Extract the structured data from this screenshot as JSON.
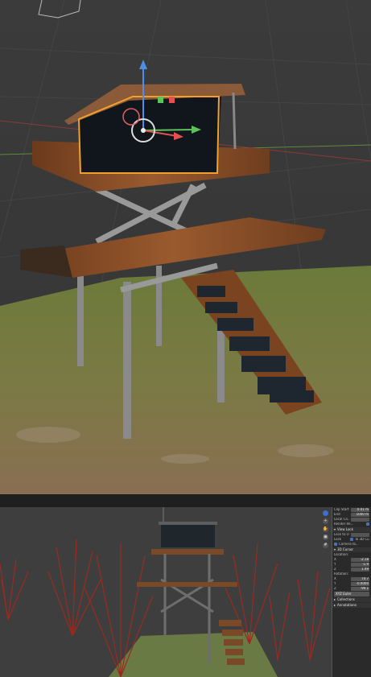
{
  "top_viewport": {
    "description_icons": [
      "translate-gizmo-icon",
      "camera-wireframe-icon"
    ]
  },
  "bottom_viewport": {
    "n_panel": {
      "rows": [
        {
          "label": "Clip Start",
          "value": "0.01 m"
        },
        {
          "label": "End",
          "value": "1000 m"
        },
        {
          "label": "Local Ca...",
          "value": ""
        },
        {
          "label": "Render Re...",
          "value": ""
        }
      ],
      "view_lock_header": "View Lock",
      "lock_object_label": "Lock to Ob...",
      "lock_rows": [
        {
          "label": "Lock",
          "value": "To 3D Cur..."
        },
        {
          "label": "",
          "value": "Camera to..."
        }
      ],
      "cursor_header": "3D Cursor",
      "location_label": "Location:",
      "location": [
        {
          "axis": "X",
          "value": "-2.18"
        },
        {
          "axis": "Y",
          "value": "-1.9"
        },
        {
          "axis": "Z",
          "value": "1.49"
        }
      ],
      "rotation_label": "Rotation:",
      "rotation": [
        {
          "axis": "X",
          "value": "74.7"
        },
        {
          "axis": "Y",
          "value": "-0.0000"
        },
        {
          "axis": "Z",
          "value": "-99.1"
        }
      ],
      "rotation_mode": "XYZ Euler",
      "collections_header": "Collections",
      "annotations_header": "Annotations"
    }
  }
}
